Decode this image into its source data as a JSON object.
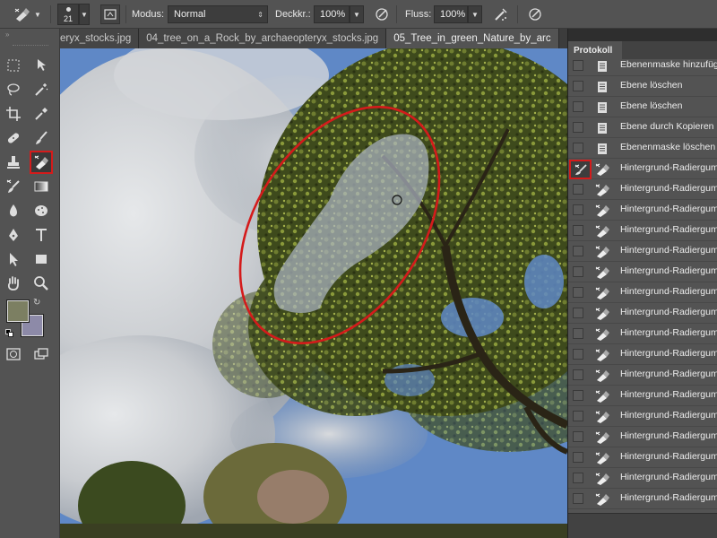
{
  "options_bar": {
    "brush_size": "21",
    "mode_label": "Modus:",
    "mode_value": "Normal",
    "opacity_label": "Deckkr.:",
    "opacity_value": "100%",
    "flow_label": "Fluss:",
    "flow_value": "100%"
  },
  "document_tabs": [
    {
      "label": "eryx_stocks.jpg",
      "active": false
    },
    {
      "label": "04_tree_on_a_Rock_by_archaeopteryx_stocks.jpg",
      "active": false
    },
    {
      "label": "05_Tree_in_green_Nature_by_arc",
      "active": true
    }
  ],
  "toolbox": {
    "active_tool": "background-eraser-tool",
    "foreground_color": "#7c7f62",
    "background_color": "#8d8aa8",
    "highlight_color": "#d41b1b"
  },
  "history_panel": {
    "title": "Protokoll",
    "items": [
      {
        "label": "Ebenenmaske hinzufügen",
        "icon": "document-icon"
      },
      {
        "label": "Ebene löschen",
        "icon": "document-icon"
      },
      {
        "label": "Ebene löschen",
        "icon": "document-icon"
      },
      {
        "label": "Ebene durch Kopieren",
        "icon": "document-icon"
      },
      {
        "label": "Ebenenmaske löschen",
        "icon": "document-icon"
      },
      {
        "label": "Hintergrund-Radiergummi",
        "icon": "background-eraser-icon",
        "history_source": true
      },
      {
        "label": "Hintergrund-Radiergummi",
        "icon": "background-eraser-icon"
      },
      {
        "label": "Hintergrund-Radiergummi",
        "icon": "background-eraser-icon"
      },
      {
        "label": "Hintergrund-Radiergummi",
        "icon": "background-eraser-icon"
      },
      {
        "label": "Hintergrund-Radiergummi",
        "icon": "background-eraser-icon"
      },
      {
        "label": "Hintergrund-Radiergummi",
        "icon": "background-eraser-icon"
      },
      {
        "label": "Hintergrund-Radiergummi",
        "icon": "background-eraser-icon"
      },
      {
        "label": "Hintergrund-Radiergummi",
        "icon": "background-eraser-icon"
      },
      {
        "label": "Hintergrund-Radiergummi",
        "icon": "background-eraser-icon"
      },
      {
        "label": "Hintergrund-Radiergummi",
        "icon": "background-eraser-icon"
      },
      {
        "label": "Hintergrund-Radiergummi",
        "icon": "background-eraser-icon"
      },
      {
        "label": "Hintergrund-Radiergummi",
        "icon": "background-eraser-icon"
      },
      {
        "label": "Hintergrund-Radiergummi",
        "icon": "background-eraser-icon"
      },
      {
        "label": "Hintergrund-Radiergummi",
        "icon": "background-eraser-icon"
      },
      {
        "label": "Hintergrund-Radiergummi",
        "icon": "background-eraser-icon"
      },
      {
        "label": "Hintergrund-Radiergummi",
        "icon": "background-eraser-icon"
      },
      {
        "label": "Hintergrund-Radiergummi",
        "icon": "background-eraser-icon"
      }
    ]
  },
  "annotation": {
    "color": "#d41b1b"
  }
}
